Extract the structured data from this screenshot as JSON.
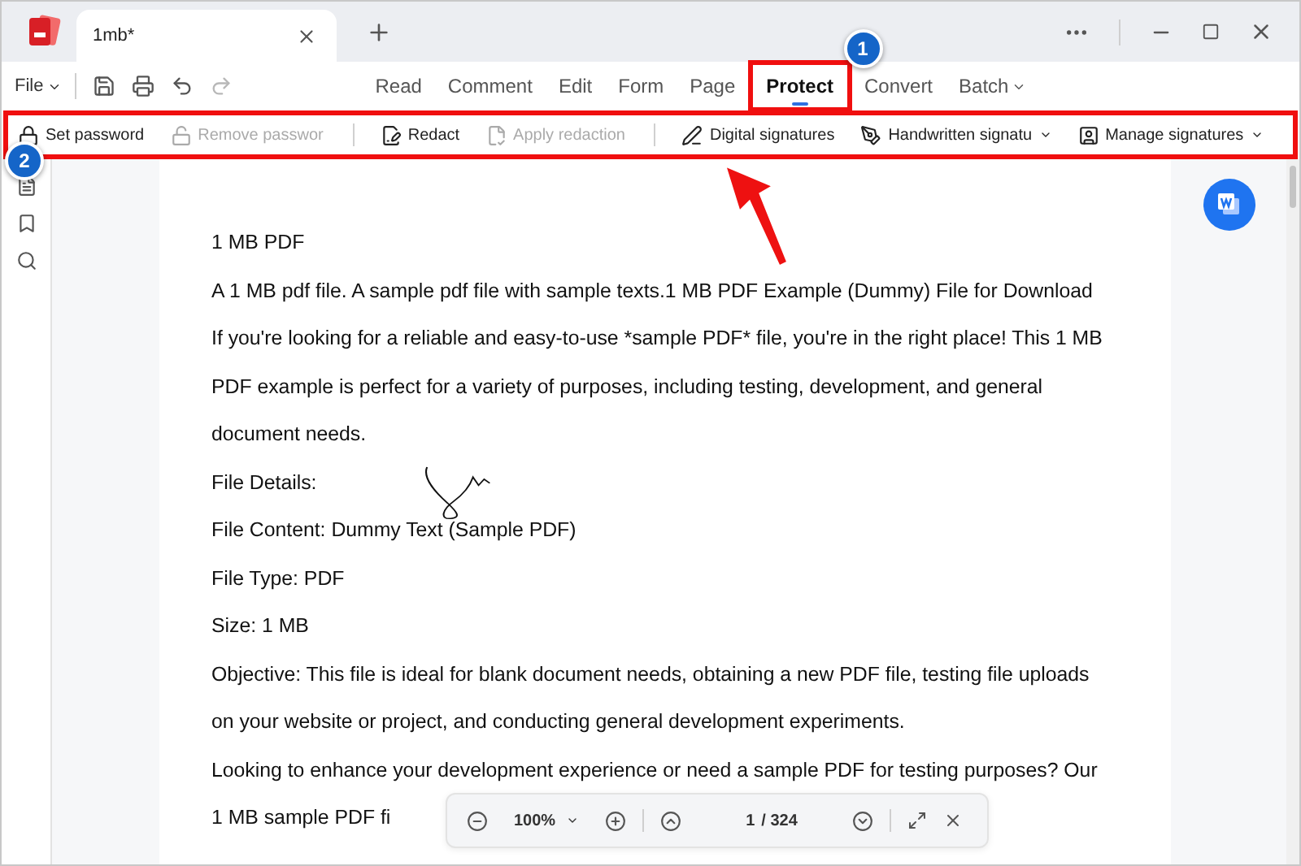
{
  "title_bar": {
    "tab_title": "1mb*"
  },
  "menu_bar": {
    "file_menu": {
      "label": "File",
      "dropdown": true
    },
    "quick_tools": [
      {
        "disabled": false
      },
      {
        "disabled": false
      },
      {
        "disabled": false
      },
      {
        "disabled": true
      }
    ],
    "tabs": [
      {
        "label": "Read",
        "selected": false,
        "dropdown": false
      },
      {
        "label": "Comment",
        "selected": false,
        "dropdown": false
      },
      {
        "label": "Edit",
        "selected": false,
        "dropdown": false
      },
      {
        "label": "Form",
        "selected": false,
        "dropdown": false
      },
      {
        "label": "Page",
        "selected": false,
        "dropdown": false
      },
      {
        "label": "Protect",
        "selected": true,
        "dropdown": false,
        "callout": {
          "badge": "1"
        }
      },
      {
        "label": "Convert",
        "selected": false,
        "dropdown": false
      },
      {
        "label": "Batch",
        "selected": false,
        "dropdown": true
      }
    ]
  },
  "toolbar": {
    "callout": {
      "badge": "2",
      "arrow": true
    },
    "groups": [
      [
        {
          "label": "Set password",
          "disabled": false,
          "dropdown": false
        },
        {
          "label": "Remove passwor",
          "disabled": true,
          "dropdown": false
        }
      ],
      [
        {
          "label": "Redact",
          "disabled": false,
          "dropdown": false
        },
        {
          "label": "Apply redaction",
          "disabled": true,
          "dropdown": false
        }
      ],
      [
        {
          "label": "Digital signatures",
          "disabled": false,
          "dropdown": false
        },
        {
          "label": "Handwritten signatu",
          "disabled": false,
          "dropdown": true
        },
        {
          "label": "Manage signatures",
          "disabled": false,
          "dropdown": true
        }
      ]
    ]
  },
  "document": {
    "lines": [
      "1 MB PDF",
      "A 1 MB pdf file. A sample pdf file with sample texts.1 MB PDF Example (Dummy) File for Download",
      "If you're looking for a reliable and easy-to-use *sample PDF* file, you're in the right place! This 1 MB",
      "PDF example is perfect for a variety of purposes, including testing, development, and general",
      "document needs.",
      "File Details:",
      "File Content: Dummy Text (Sample PDF)",
      "File Type: PDF",
      "Size: 1 MB",
      "Objective: This file is ideal for blank document needs, obtaining a new PDF file, testing file uploads",
      "on your website or project, and conducting general development experiments.",
      "Looking to enhance your development experience or need a sample PDF for testing purposes? Our",
      "1 MB sample PDF fi"
    ],
    "signature": true
  },
  "zoom_bar": {
    "zoom": "100%",
    "page": "1",
    "total": "/ 324"
  }
}
